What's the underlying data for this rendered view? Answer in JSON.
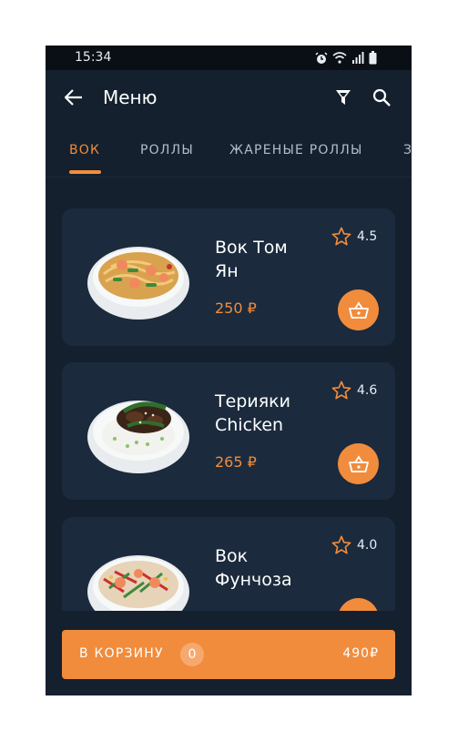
{
  "status_bar": {
    "time": "15:34",
    "icons": [
      "alarm-icon",
      "wifi-icon",
      "signal-icon",
      "battery-icon"
    ]
  },
  "app_bar": {
    "title": "Меню",
    "back_icon": "arrow-left-icon",
    "filter_icon": "filter-icon",
    "search_icon": "search-icon"
  },
  "tabs": [
    {
      "label": "ВОК",
      "active": true
    },
    {
      "label": "РОЛЛЫ",
      "active": false
    },
    {
      "label": "ЖАРЕНЫЕ РОЛЛЫ",
      "active": false
    },
    {
      "label": "З",
      "active": false
    }
  ],
  "products": [
    {
      "name": "Вок Том Ян",
      "price": "250 ₽",
      "rating": "4.5",
      "image": "wok-tom-yam-photo"
    },
    {
      "name": "Терияки Chicken",
      "price": "265 ₽",
      "rating": "4.6",
      "image": "teriyaki-chicken-photo"
    },
    {
      "name": "Вок Фунчоза",
      "price": "",
      "rating": "4.0",
      "image": "wok-funchoza-photo"
    }
  ],
  "cart_bar": {
    "label": "В КОРЗИНУ",
    "count": "0",
    "total": "490₽"
  },
  "colors": {
    "background": "#14202e",
    "card": "#1b2a3d",
    "accent": "#f18c3c",
    "status_bar": "#0a0f15"
  }
}
